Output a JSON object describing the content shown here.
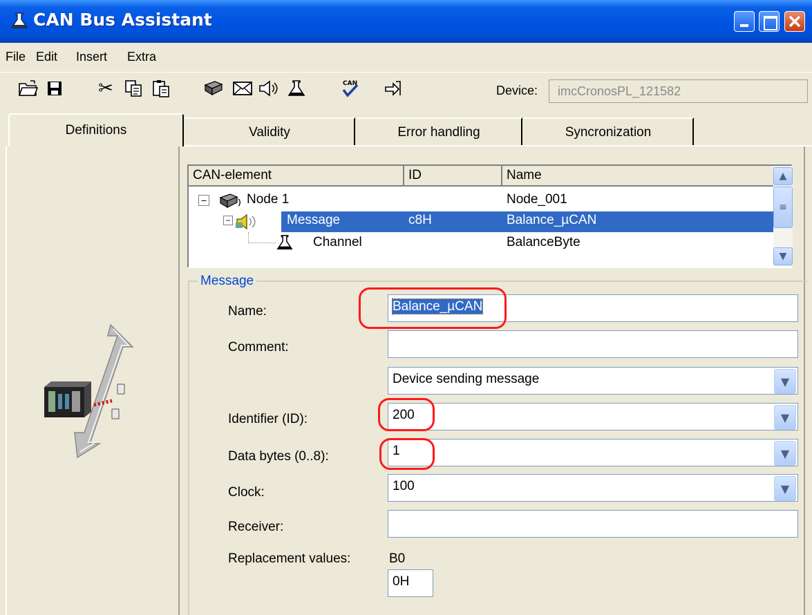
{
  "window": {
    "title": "CAN Bus Assistant"
  },
  "menu": [
    "File",
    "Edit",
    "Insert",
    "Extra"
  ],
  "toolbar": {
    "icons": [
      "open-icon",
      "save-icon",
      "cut-icon",
      "copy-icon",
      "paste-icon",
      "node-icon",
      "message-icon",
      "message-speaker-icon",
      "channel-flask-icon",
      "can-check-icon",
      "import-icon"
    ],
    "device_label": "Device:",
    "device_value": "imcCronosPL_121582"
  },
  "tabs": [
    "Definitions",
    "Validity",
    "Error handling",
    "Syncronization"
  ],
  "tree": {
    "columns": [
      "CAN-element",
      "ID",
      "Name"
    ],
    "rows": [
      {
        "element": "Node 1",
        "id": "",
        "name": "Node_001"
      },
      {
        "element": "Message",
        "id": "c8H",
        "name": "Balance_µCAN"
      },
      {
        "element": "Channel",
        "id": "",
        "name": "BalanceByte"
      }
    ]
  },
  "message_group": {
    "title": "Message",
    "name_label": "Name:",
    "name_value": "Balance_µCAN",
    "comment_label": "Comment:",
    "comment_value": "",
    "direction_value": "Device sending message",
    "identifier_label": "Identifier (ID):",
    "identifier_value": "200",
    "databytes_label": "Data bytes (0..8):",
    "databytes_value": "1",
    "clock_label": "Clock:",
    "clock_value": "100",
    "receiver_label": "Receiver:",
    "receiver_value": "",
    "replacement_label": "Replacement values:",
    "replacement_byte": "B0",
    "replacement_value": "0H"
  },
  "colors": {
    "titlebar": "#0054e3",
    "selection": "#316ac5",
    "highlight": "#ff1a1a",
    "group_title": "#0046d5"
  }
}
